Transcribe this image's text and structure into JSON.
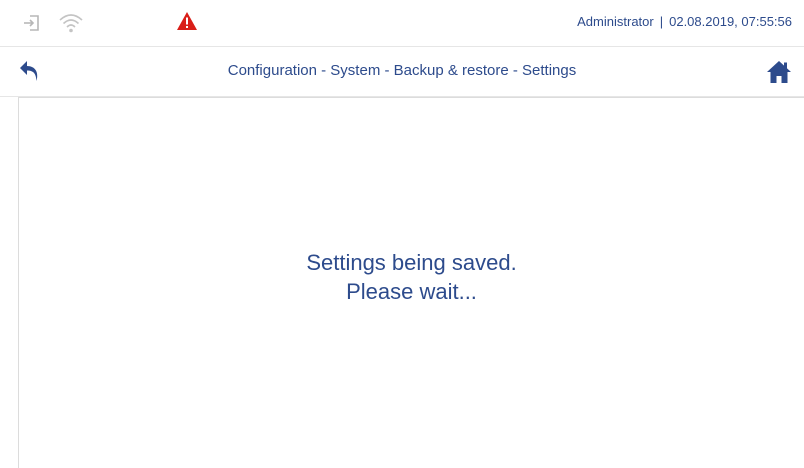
{
  "status_bar": {
    "user": "Administrator",
    "separator": "|",
    "datetime": "02.08.2019, 07:55:56",
    "icons": {
      "login": "login-icon",
      "wifi": "wifi-icon",
      "warning": "warning-icon"
    },
    "colors": {
      "warning": "#d91e18",
      "icon_muted": "#b7b7b7",
      "text": "#2d4b8c"
    }
  },
  "nav_bar": {
    "breadcrumb": "Configuration - System - Backup & restore - Settings",
    "icons": {
      "back": "back-arrow-icon",
      "home": "home-icon"
    },
    "colors": {
      "icon": "#2d4b8c"
    }
  },
  "content": {
    "message_line1": "Settings being saved.",
    "message_line2": "Please wait..."
  }
}
